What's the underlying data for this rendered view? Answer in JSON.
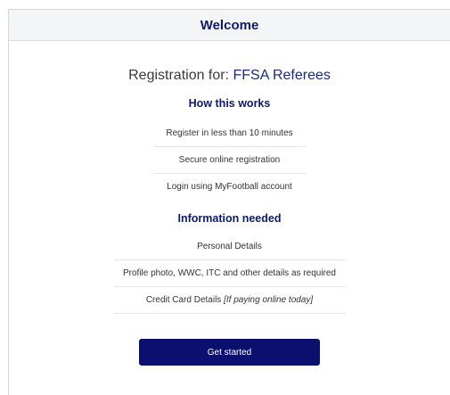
{
  "header": {
    "title": "Welcome"
  },
  "registration": {
    "prefix": "Registration for:",
    "org": "FFSA Referees"
  },
  "how_it_works": {
    "heading": "How this works",
    "items": [
      "Register in less than 10 minutes",
      "Secure online registration",
      "Login using MyFootball account"
    ]
  },
  "info_needed": {
    "heading": "Information needed",
    "items": [
      {
        "text": "Personal Details",
        "note": ""
      },
      {
        "text": "Profile photo, WWC, ITC and other details as required",
        "note": ""
      },
      {
        "text": "Credit Card Details ",
        "note": "[If paying online today]"
      }
    ]
  },
  "actions": {
    "get_started": "Get started"
  },
  "colors": {
    "brand_navy": "#0b0f6e",
    "heading_navy": "#0e1a6b",
    "header_bg": "#f4f5f7"
  }
}
